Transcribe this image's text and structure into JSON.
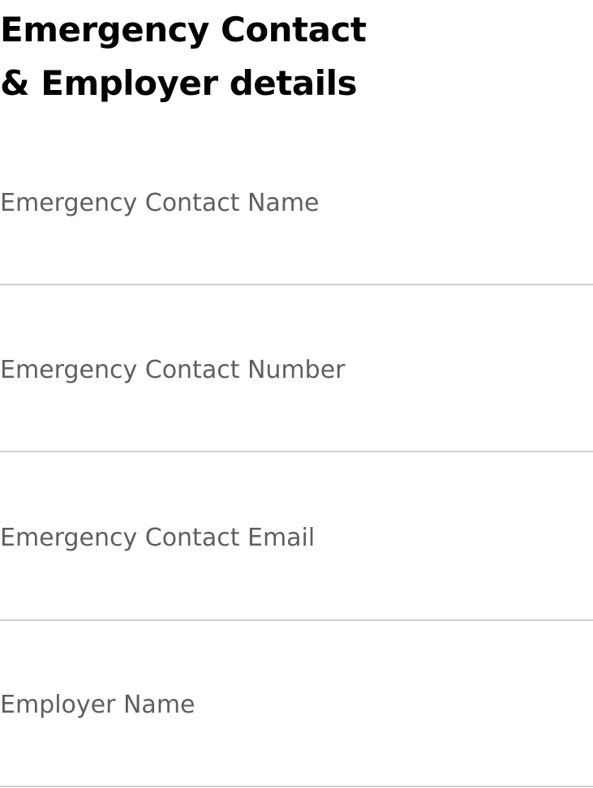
{
  "header": {
    "title_line1": "Emergency Contact",
    "title_line2": "& Employer details"
  },
  "fields": [
    {
      "placeholder": "Emergency Contact Name",
      "value": ""
    },
    {
      "placeholder": "Emergency Contact Number",
      "value": ""
    },
    {
      "placeholder": "Emergency Contact Email",
      "value": ""
    },
    {
      "placeholder": "Employer Name",
      "value": ""
    }
  ],
  "colors": {
    "title": "#000000",
    "placeholder": "#5f5f5f",
    "divider": "#cfcfcf",
    "background": "#ffffff"
  }
}
